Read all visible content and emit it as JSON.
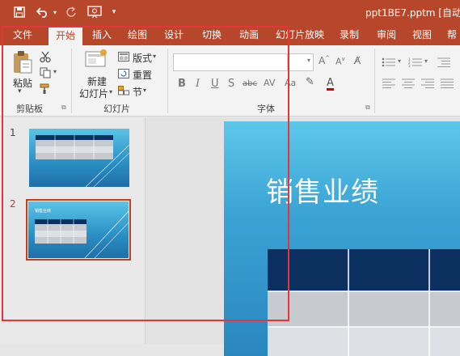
{
  "window": {
    "title": "ppt1BE7.pptm [自动保"
  },
  "tabs": [
    {
      "label": "文件",
      "active": false
    },
    {
      "label": "开始",
      "active": true
    },
    {
      "label": "插入",
      "active": false
    },
    {
      "label": "绘图",
      "active": false
    },
    {
      "label": "设计",
      "active": false
    },
    {
      "label": "切换",
      "active": false
    },
    {
      "label": "动画",
      "active": false
    },
    {
      "label": "幻灯片放映",
      "active": false
    },
    {
      "label": "录制",
      "active": false
    },
    {
      "label": "审阅",
      "active": false
    },
    {
      "label": "视图",
      "active": false
    },
    {
      "label": "帮",
      "active": false
    }
  ],
  "ribbon": {
    "clipboard": {
      "paste": "粘贴",
      "group": "剪贴板"
    },
    "slides": {
      "new_line1": "新建",
      "new_line2": "幻灯片",
      "layout": "版式",
      "reset": "重置",
      "section": "节",
      "group": "幻灯片"
    },
    "font": {
      "group": "字体",
      "bold": "B",
      "italic": "I",
      "underline": "U",
      "strike": "S"
    }
  },
  "thumbnails": [
    {
      "number": "1",
      "title": ""
    },
    {
      "number": "2",
      "title": "销售业绩"
    }
  ],
  "slide": {
    "title": "销售业绩"
  },
  "colors": {
    "accent": "#b7472a",
    "highlight": "#e8333a",
    "table_header": "#0b2f5e"
  }
}
